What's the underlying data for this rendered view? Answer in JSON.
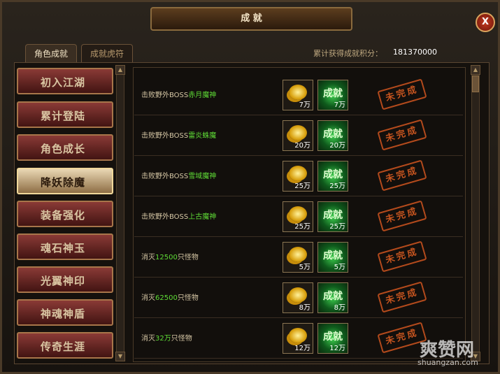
{
  "window": {
    "title": "成 就",
    "close_label": "X"
  },
  "tabs": [
    {
      "label": "角色成就",
      "active": true
    },
    {
      "label": "成就虎符",
      "active": false
    }
  ],
  "score": {
    "label": "累计获得成就积分：",
    "value": "181370000"
  },
  "sidebar": {
    "items": [
      {
        "label": "初入江湖",
        "active": false
      },
      {
        "label": "累计登陆",
        "active": false
      },
      {
        "label": "角色成长",
        "active": false
      },
      {
        "label": "降妖除魔",
        "active": true
      },
      {
        "label": "装备强化",
        "active": false
      },
      {
        "label": "魂石神玉",
        "active": false
      },
      {
        "label": "光翼神印",
        "active": false
      },
      {
        "label": "神魂神盾",
        "active": false
      },
      {
        "label": "传奇生涯",
        "active": false
      }
    ]
  },
  "achievements": [
    {
      "prefix": "击败野外BOSS",
      "highlight": "赤月魔神",
      "suffix": "",
      "coin_qty": "7万",
      "ach_label": "成就",
      "ach_qty": "7万",
      "status": "未完成"
    },
    {
      "prefix": "击败野外BOSS",
      "highlight": "雷炎蛛魔",
      "suffix": "",
      "coin_qty": "20万",
      "ach_label": "成就",
      "ach_qty": "20万",
      "status": "未完成"
    },
    {
      "prefix": "击败野外BOSS",
      "highlight": "雪域魔神",
      "suffix": "",
      "coin_qty": "25万",
      "ach_label": "成就",
      "ach_qty": "25万",
      "status": "未完成"
    },
    {
      "prefix": "击败野外BOSS",
      "highlight": "上古魔神",
      "suffix": "",
      "coin_qty": "25万",
      "ach_label": "成就",
      "ach_qty": "25万",
      "status": "未完成"
    },
    {
      "prefix": "消灭",
      "highlight": "12500",
      "suffix": "只怪物",
      "coin_qty": "5万",
      "ach_label": "成就",
      "ach_qty": "5万",
      "status": "未完成"
    },
    {
      "prefix": "消灭",
      "highlight": "62500",
      "suffix": "只怪物",
      "coin_qty": "8万",
      "ach_label": "成就",
      "ach_qty": "8万",
      "status": "未完成"
    },
    {
      "prefix": "消灭",
      "highlight": "32万",
      "suffix": "只怪物",
      "coin_qty": "12万",
      "ach_label": "成就",
      "ach_qty": "12万",
      "status": "未完成"
    }
  ],
  "watermark": {
    "name": "爽赞网",
    "url": "shuangzan.com"
  },
  "colors": {
    "highlight": "#5fdc36",
    "stamp": "#c5541f",
    "active_side": "#e9d7b3"
  }
}
